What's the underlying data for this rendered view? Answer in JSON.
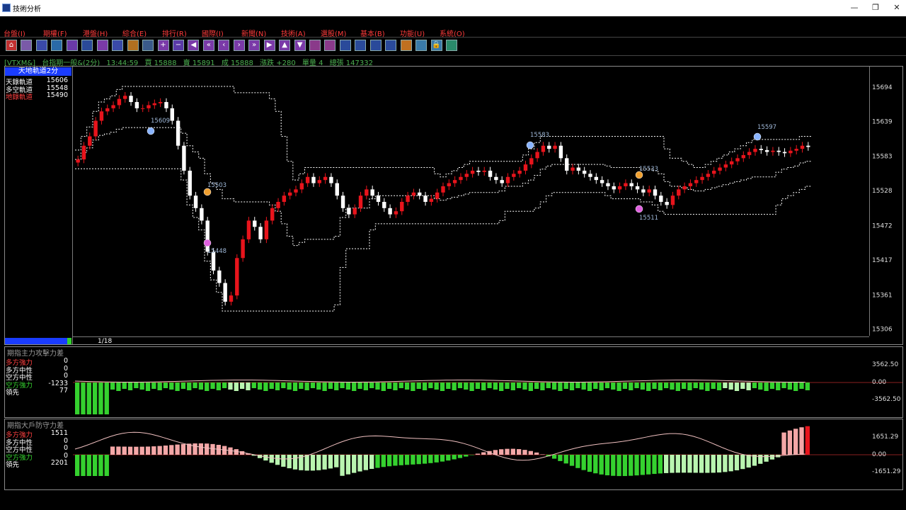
{
  "window": {
    "title": "技術分析"
  },
  "menu": [
    "台盤(I)",
    "期權(F)",
    "港盤(H)",
    "綜合(E)",
    "排行(R)",
    "國際(I)",
    "新聞(N)",
    "技術(A)",
    "選股(M)",
    "基本(B)",
    "功能(U)",
    "系統(O)"
  ],
  "toolbar_icons": [
    "home-icon",
    "calendar-icon",
    "shop-icon",
    "grid-icon",
    "news-icon",
    "info-icon",
    "chart-icon",
    "self-icon",
    "bag-icon",
    "table-icon",
    "plus-icon",
    "minus-icon",
    "left-icon",
    "double-left-icon",
    "prev-icon",
    "next-icon",
    "double-right-icon",
    "right-icon",
    "up-icon",
    "down-icon",
    "chart-a-icon",
    "chart-b-icon",
    "link-icon",
    "link2-icon",
    "export-icon",
    "print-icon",
    "book-icon",
    "window-icon",
    "lock-icon",
    "calc-icon"
  ],
  "info": {
    "symbol": "[VTXM&]",
    "name": "台指期一般&(2分)",
    "time": "13:44:59",
    "bid": "買 15888",
    "ask": "賣 15891",
    "last": "成 15888",
    "change": "漲跌 +280",
    "vol": "單量 4",
    "total": "總張 147332"
  },
  "main_badge": "天地軌道2分",
  "main_legend": [
    {
      "label": "天錄軌道",
      "value": "15606",
      "color": "#ffffff"
    },
    {
      "label": "多空軌道",
      "value": "15548",
      "color": "#ffffff"
    },
    {
      "label": "地錄軌道",
      "value": "15490",
      "color": "#ff4040"
    }
  ],
  "price_ticks": [
    "15694",
    "15639",
    "15583",
    "15528",
    "15472",
    "15417",
    "15361",
    "15306"
  ],
  "annotations": [
    "15609",
    "15583",
    "15597",
    "15503",
    "15533",
    "15511",
    "15448"
  ],
  "date_label": "1/18",
  "panel1": {
    "title": "期指主力攻擊力差",
    "rows": [
      {
        "label": "多方強力",
        "value": "0",
        "color": "#ff4040"
      },
      {
        "label": "多方中性",
        "value": "0",
        "color": "#ffffff"
      },
      {
        "label": "空方中性",
        "value": "0",
        "color": "#ffffff"
      },
      {
        "label": "空方強力",
        "value": "-1233",
        "color": "#35d12f"
      },
      {
        "label": "領先",
        "value": "77",
        "color": "#ffffff"
      }
    ],
    "axis": [
      "3562.50",
      "0.00",
      "-3562.50"
    ]
  },
  "panel2": {
    "title": "期指大戶防守力差",
    "rows": [
      {
        "label": "多方強力",
        "value": "1511",
        "color": "#ff4040"
      },
      {
        "label": "多方中性",
        "value": "0",
        "color": "#ffffff"
      },
      {
        "label": "空方中性",
        "value": "0",
        "color": "#ffffff"
      },
      {
        "label": "空方強力",
        "value": "0",
        "color": "#35d12f"
      },
      {
        "label": "領先",
        "value": "2201",
        "color": "#ffffff"
      }
    ],
    "axis": [
      "1651.29",
      "0.00",
      "-1651.29"
    ]
  },
  "colors": {
    "up": "#e8141c",
    "down": "#ffffff",
    "green": "#35d12f",
    "pink": "#f4a7a7",
    "lightgreen": "#b9f5b0",
    "accent": "#1a3cff"
  },
  "chart_data": {
    "type": "candlestick",
    "ylim": [
      15300,
      15720
    ],
    "series": [
      {
        "name": "close",
        "values": [
          15578,
          15600,
          15615,
          15640,
          15655,
          15660,
          15665,
          15675,
          15680,
          15670,
          15660,
          15660,
          15665,
          15668,
          15670,
          15660,
          15640,
          15600,
          15560,
          15520,
          15500,
          15480,
          15430,
          15400,
          15380,
          15350,
          15360,
          15420,
          15450,
          15480,
          15470,
          15450,
          15480,
          15500,
          15510,
          15520,
          15525,
          15530,
          15540,
          15550,
          15540,
          15545,
          15550,
          15540,
          15520,
          15500,
          15490,
          15500,
          15520,
          15530,
          15520,
          15510,
          15500,
          15490,
          15495,
          15510,
          15520,
          15525,
          15520,
          15510,
          15515,
          15525,
          15535,
          15540,
          15545,
          15550,
          15555,
          15560,
          15558,
          15560,
          15550,
          15545,
          15540,
          15550,
          15555,
          15560,
          15570,
          15580,
          15590,
          15600,
          15595,
          15600,
          15580,
          15560,
          15565,
          15560,
          15555,
          15550,
          15545,
          15540,
          15535,
          15530,
          15535,
          15540,
          15535,
          15530,
          15525,
          15530,
          15520,
          15510,
          15505,
          15520,
          15530,
          15535,
          15540,
          15545,
          15550,
          15555,
          15560,
          15565,
          15570,
          15575,
          15580,
          15585,
          15590,
          15595,
          15593,
          15590,
          15592,
          15590,
          15588,
          15592,
          15595,
          15600,
          15598
        ]
      }
    ]
  }
}
